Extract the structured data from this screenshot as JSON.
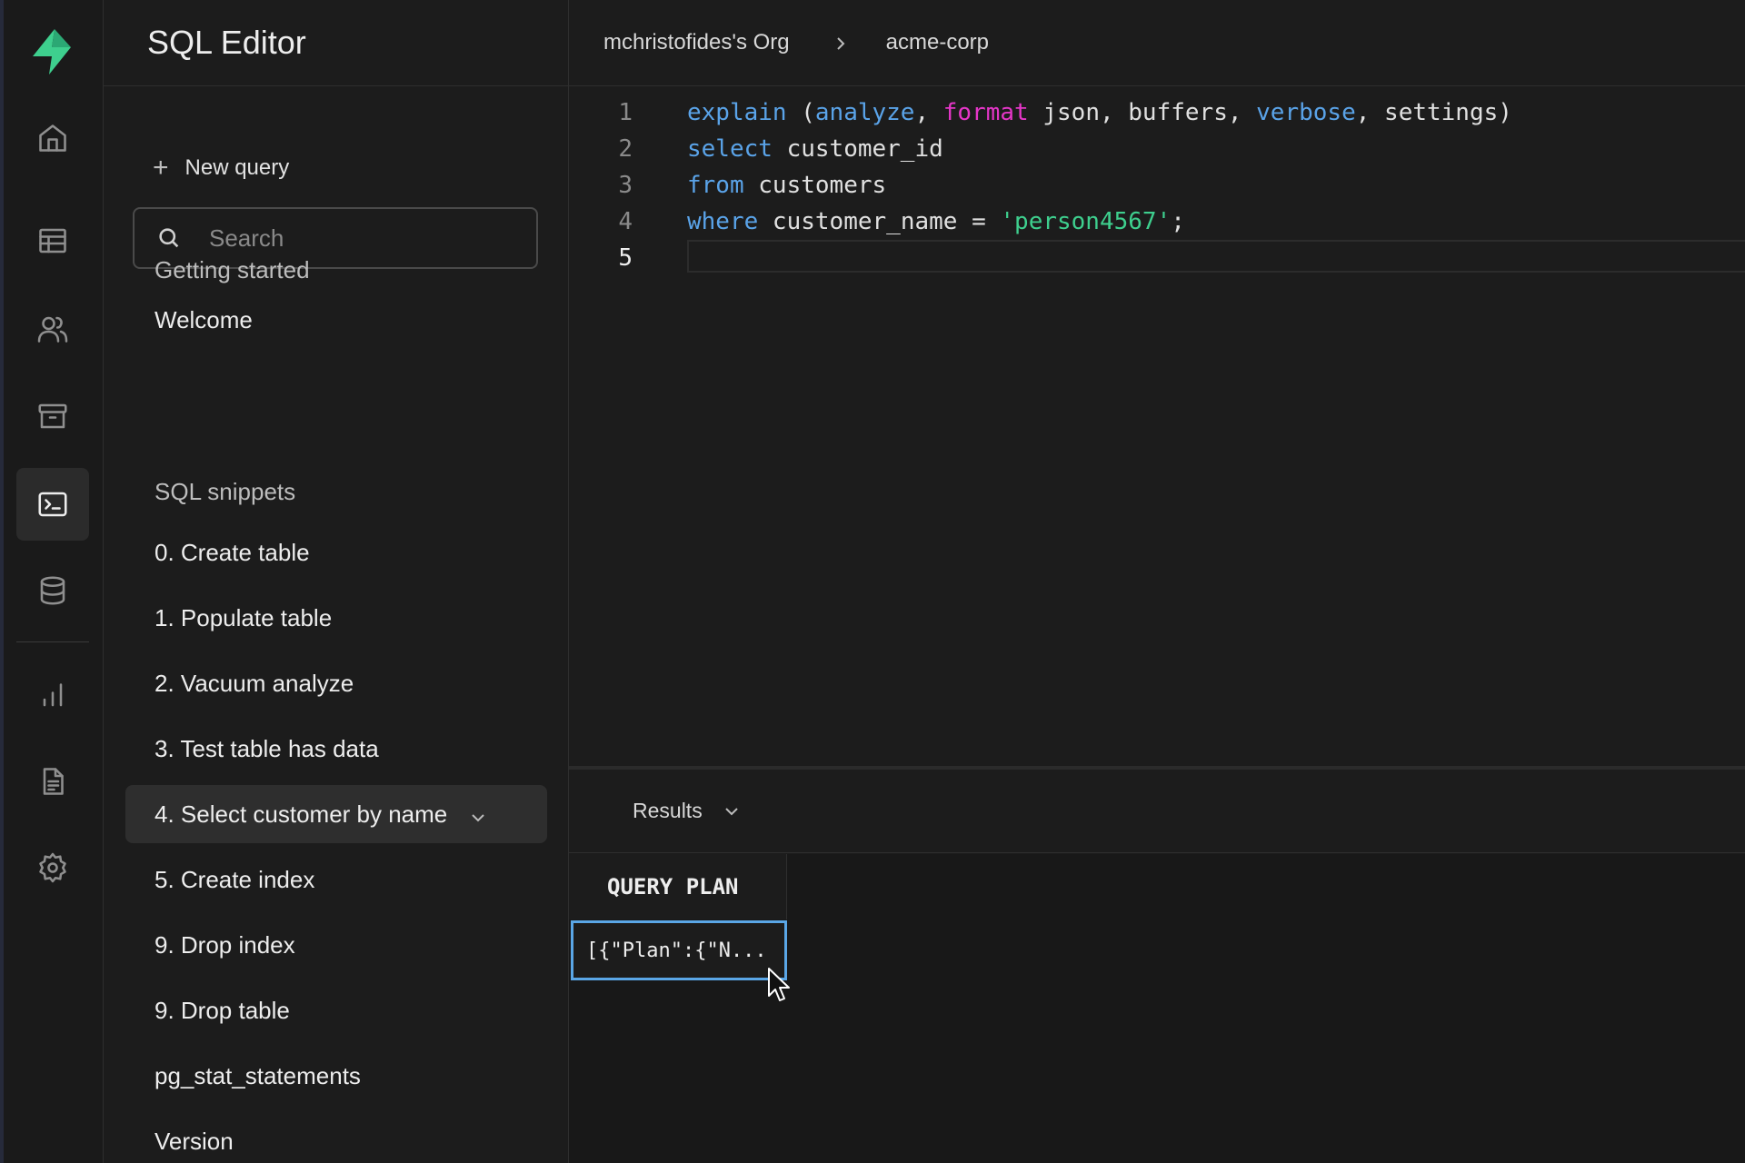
{
  "app": {
    "title": "SQL Editor",
    "brand_color": "#3ecf8e"
  },
  "rail": {
    "icons": [
      "supabase-logo-icon",
      "home-icon",
      "table-editor-icon",
      "users-icon",
      "storage-icon",
      "sql-editor-icon",
      "database-icon",
      "reports-icon",
      "docs-icon",
      "settings-icon"
    ],
    "active": "sql-editor-icon"
  },
  "sidebar": {
    "new_query_label": "New query",
    "search_placeholder": "Search",
    "section_getting_started": "Getting started",
    "getting_started_items": [
      "Welcome"
    ],
    "section_snippets": "SQL snippets",
    "snippets": [
      "0. Create table",
      "1. Populate table",
      "2. Vacuum analyze",
      "3. Test table has data",
      "4. Select customer by name",
      "5. Create index",
      "9. Drop index",
      "9. Drop table",
      "pg_stat_statements",
      "Version"
    ],
    "active_snippet": "4. Select customer by name"
  },
  "breadcrumb": {
    "org": "mchristofides's Org",
    "project": "acme-corp"
  },
  "editor": {
    "line_numbers": [
      "1",
      "2",
      "3",
      "4",
      "5"
    ],
    "current_line": "5",
    "line1": {
      "kw_explain": "explain",
      "p1": " (",
      "kw_analyze": "analyze",
      "p2": ", ",
      "kw_format": "format",
      "p3": " json, buffers, ",
      "kw_verbose": "verbose",
      "p4": ", settings)"
    },
    "line2": {
      "kw_select": "select",
      "p1": " customer_id"
    },
    "line3": {
      "kw_from": "from",
      "p1": " customers"
    },
    "line4": {
      "kw_where": "where",
      "p1": " customer_name = ",
      "str": "'person4567'",
      "p2": ";"
    }
  },
  "results": {
    "label": "Results",
    "column_header": "QUERY PLAN",
    "cell_value": "[{\"Plan\":{\"N..."
  }
}
